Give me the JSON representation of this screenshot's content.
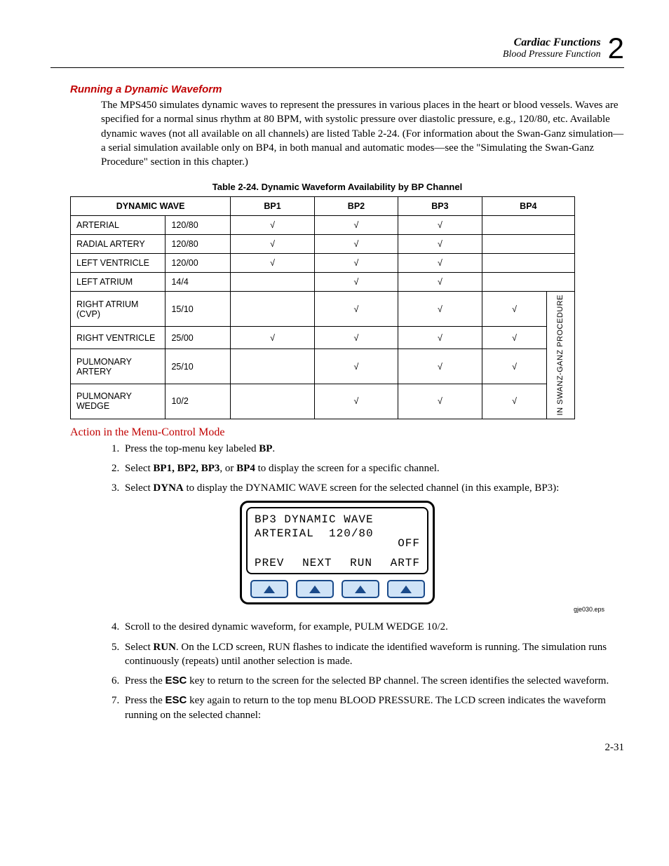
{
  "header": {
    "title1": "Cardiac Functions",
    "title2": "Blood Pressure Function",
    "chapter_num": "2"
  },
  "section_heading": "Running a Dynamic Waveform",
  "body_para": "The MPS450 simulates dynamic waves to represent the pressures in various places in the heart or blood vessels. Waves are specified for a normal sinus rhythm at 80 BPM, with systolic pressure over diastolic pressure, e.g., 120/80, etc. Available dynamic waves (not all available on all channels) are listed Table 2-24. (For information about the Swan-Ganz simulation—a serial simulation available only on BP4, in both manual and automatic modes—see the \"Simulating the Swan-Ganz Procedure\" section in this chapter.)",
  "table": {
    "caption": "Table 2-24. Dynamic Waveform Availability by BP Channel",
    "headers": {
      "wave": "DYNAMIC WAVE",
      "bp1": "BP1",
      "bp2": "BP2",
      "bp3": "BP3",
      "bp4": "BP4"
    },
    "rows": [
      {
        "name": "ARTERIAL",
        "val": "120/80",
        "bp1": "√",
        "bp2": "√",
        "bp3": "√",
        "bp4": ""
      },
      {
        "name": "RADIAL ARTERY",
        "val": "120/80",
        "bp1": "√",
        "bp2": "√",
        "bp3": "√",
        "bp4": ""
      },
      {
        "name": "LEFT VENTRICLE",
        "val": "120/00",
        "bp1": "√",
        "bp2": "√",
        "bp3": "√",
        "bp4": ""
      },
      {
        "name": "LEFT ATRIUM",
        "val": "14/4",
        "bp1": "",
        "bp2": "√",
        "bp3": "√",
        "bp4": ""
      },
      {
        "name": "RIGHT ATRIUM (CVP)",
        "val": "15/10",
        "bp1": "",
        "bp2": "√",
        "bp3": "√",
        "bp4": "√"
      },
      {
        "name": "RIGHT VENTRICLE",
        "val": "25/00",
        "bp1": "√",
        "bp2": "√",
        "bp3": "√",
        "bp4": "√"
      },
      {
        "name": "PULMONARY ARTERY",
        "val": "25/10",
        "bp1": "",
        "bp2": "√",
        "bp3": "√",
        "bp4": "√"
      },
      {
        "name": "PULMONARY WEDGE",
        "val": "10/2",
        "bp1": "",
        "bp2": "√",
        "bp3": "√",
        "bp4": "√"
      }
    ],
    "side_label": "IN SWANZ-GANZ PROCEDURE"
  },
  "subheading": "Action in the Menu-Control Mode",
  "steps": {
    "s1a": "Press the top-menu key labeled ",
    "s1b": "BP",
    "s1c": ".",
    "s2a": "Select ",
    "s2b": "BP1, BP2, BP3",
    "s2c": ", or ",
    "s2d": "BP4",
    "s2e": " to display the screen for a specific channel.",
    "s3a": "Select ",
    "s3b": "DYNA",
    "s3c": " to display the DYNAMIC WAVE screen for the selected channel (in this example, BP3):",
    "s4": "Scroll to the desired dynamic waveform, for example, PULM WEDGE 10/2.",
    "s5a": "Select ",
    "s5b": "RUN",
    "s5c": ". On the LCD screen, RUN flashes to indicate the identified waveform is running. The simulation runs continuously (repeats) until another selection is made.",
    "s6a": "Press the ",
    "s6b": "ESC",
    "s6c": " key to return to the screen for the selected BP channel. The screen identifies the selected waveform.",
    "s7a": "Press the ",
    "s7b": "ESC",
    "s7c": " key again to return to the top menu BLOOD PRESSURE. The LCD screen indicates the waveform running on the selected channel:"
  },
  "lcd": {
    "line1": "BP3 DYNAMIC WAVE",
    "line2": "ARTERIAL  120/80",
    "off": "OFF",
    "b1": "PREV",
    "b2": "NEXT",
    "b3": "RUN",
    "b4": "ARTF"
  },
  "eps_label": "gje030.eps",
  "page_num": "2-31"
}
